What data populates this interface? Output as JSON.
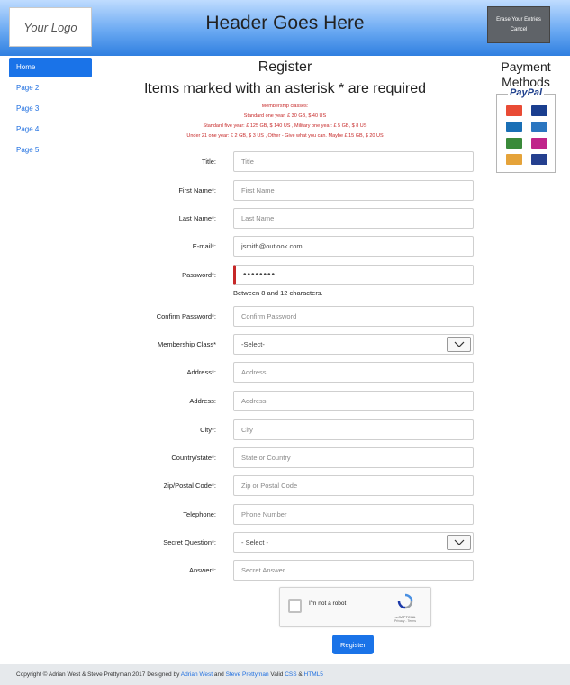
{
  "header": {
    "logo": "Your Logo",
    "title": "Header Goes Here",
    "erase_label": "Erase Your Entries",
    "cancel_label": "Cancel"
  },
  "sidebar": {
    "items": [
      {
        "label": "Home",
        "active": true
      },
      {
        "label": "Page 2"
      },
      {
        "label": "Page 3"
      },
      {
        "label": "Page 4"
      },
      {
        "label": "Page 5"
      }
    ]
  },
  "payment": {
    "title_line1": "Payment",
    "title_line2": "Methods",
    "paypal_label": "PayPal",
    "cards": [
      "mastercard-icon",
      "visa-icon",
      "maestro-icon",
      "amex-icon",
      "discover-icon",
      "solo-icon",
      "switch-icon",
      "visa-electron-icon"
    ],
    "card_colors": [
      "#e94b35",
      "#1a3e8f",
      "#1a6fb5",
      "#2b76c0",
      "#3a8a3a",
      "#c0248a",
      "#e5a33a",
      "#25408f"
    ]
  },
  "main": {
    "title": "Register",
    "required_note": "Items marked with an asterisk * are required",
    "notes": [
      "Membership classes:",
      "Standard one year: £ 30 GB, $ 40 US",
      "Standard five year: £ 125 GB, $ 140 US , Military one year: £ 5 GB, $ 8 US",
      "Under 21 one year: £ 2 GB, $ 3 US , Other - Give what you can. Maybe £ 15 GB, $ 20 US"
    ]
  },
  "form": {
    "title_label": "Title:",
    "title_placeholder": "Title",
    "first_label": "First Name*:",
    "first_placeholder": "First Name",
    "last_label": "Last Name*:",
    "last_placeholder": "Last Name",
    "email_label": "E-mail*:",
    "email_value": "jsmith@outlook.com",
    "password_label": "Password*:",
    "password_value": "••••••••",
    "password_help": "Between 8 and 12 characters.",
    "confirm_label": "Confirm Password*:",
    "confirm_placeholder": "Confirm Password",
    "membership_label": "Membership Class*",
    "membership_value": "-Select-",
    "address1_label": "Address*:",
    "address1_placeholder": "Address",
    "address2_label": "Address:",
    "address2_placeholder": "Address",
    "city_label": "City*:",
    "city_placeholder": "City",
    "country_label": "Country/state*:",
    "country_placeholder": "State or Country",
    "zip_label": "Zip/Postal Code*:",
    "zip_placeholder": "Zip or Postal Code",
    "phone_label": "Telephone:",
    "phone_placeholder": "Phone Number",
    "question_label": "Secret Question*:",
    "question_value": "- Select -",
    "answer_label": "Answer*:",
    "answer_placeholder": "Secret Answer"
  },
  "captcha": {
    "label": "I'm not a robot",
    "brand": "reCAPTCHA",
    "links": "Privacy - Terms"
  },
  "register_label": "Register",
  "footer": {
    "prefix": "Copyright © Adrian West & Steve Prettyman 2017 Designed by ",
    "author1": "Adrian West",
    "and1": " and ",
    "author2": "Steve Prettyman",
    "valid": " Valid ",
    "css": "CSS",
    "amp": " & ",
    "html5": "HTML5"
  }
}
